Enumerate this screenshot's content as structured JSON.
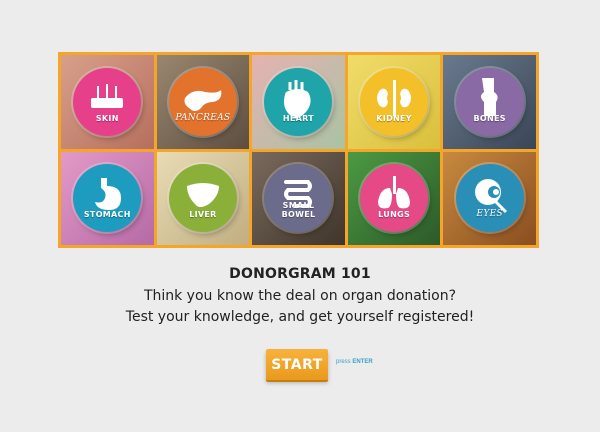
{
  "tiles": [
    {
      "label": "SKIN",
      "circle": "#e6408b",
      "bg": "#c98a76",
      "icon": "skin-icon",
      "label_style": "normal"
    },
    {
      "label": "PANCREAS",
      "circle": "#e3732c",
      "bg": "#7e6a55",
      "icon": "pancreas-icon",
      "label_style": "italic"
    },
    {
      "label": "HEART",
      "circle": "#1fa5a9",
      "bg": "#d69a9b",
      "icon": "heart-icon",
      "label_style": "normal"
    },
    {
      "label": "KIDNEY",
      "circle": "#f4c02a",
      "bg": "#e9d15a",
      "icon": "kidney-icon",
      "label_style": "normal"
    },
    {
      "label": "BONES",
      "circle": "#8a6aa5",
      "bg": "#4b5a6d",
      "icon": "bones-icon",
      "label_style": "normal"
    },
    {
      "label": "STOMACH",
      "circle": "#1d9cbf",
      "bg": "#d37eb3",
      "icon": "stomach-icon",
      "label_style": "normal"
    },
    {
      "label": "LIVER",
      "circle": "#8bb039",
      "bg": "#d6c8a0",
      "icon": "liver-icon",
      "label_style": "normal"
    },
    {
      "label": "SMALL BOWEL",
      "circle": "#6b6c8c",
      "bg": "#5c4f45",
      "icon": "small-bowel-icon",
      "label_style": "normal"
    },
    {
      "label": "LUNGS",
      "circle": "#e64a86",
      "bg": "#3e7e3a",
      "icon": "lungs-icon",
      "label_style": "normal"
    },
    {
      "label": "EYES",
      "circle": "#2a8fb6",
      "bg": "#b5702e",
      "icon": "eye-icon",
      "label_style": "italic"
    }
  ],
  "title": "DONORGRAM 101",
  "subtitle_line1": "Think you know the deal on organ donation?",
  "subtitle_line2": "Test your knowledge, and get yourself registered!",
  "start_label": "START",
  "press_text": "press",
  "press_key": "ENTER",
  "colors": {
    "accent": "#f4a52a",
    "link": "#3aa0c9",
    "background": "#ececec"
  }
}
